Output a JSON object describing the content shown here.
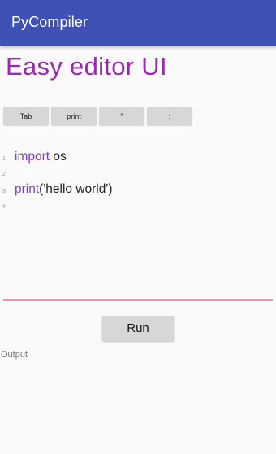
{
  "app_bar": {
    "title": "PyCompiler"
  },
  "heading": "Easy editor UI",
  "shortcuts": [
    {
      "label": "Tab"
    },
    {
      "label": "print"
    },
    {
      "label": "\""
    },
    {
      "label": ";"
    }
  ],
  "editor": {
    "line_numbers": [
      "1",
      "2",
      "3",
      "4"
    ],
    "lines": [
      {
        "keyword": "import",
        "rest": " os"
      },
      {
        "keyword": "",
        "rest": ""
      },
      {
        "keyword": "print",
        "rest": "('hello world')"
      },
      {
        "keyword": "",
        "rest": ""
      }
    ]
  },
  "run_button": {
    "label": "Run"
  },
  "output": {
    "label": "Output",
    "text": ""
  },
  "colors": {
    "app_bar": "#3f51b5",
    "heading": "#9c27b0",
    "keyword": "#7b3fbf",
    "underline": "#f48fb1",
    "button": "#d6d7d7"
  }
}
